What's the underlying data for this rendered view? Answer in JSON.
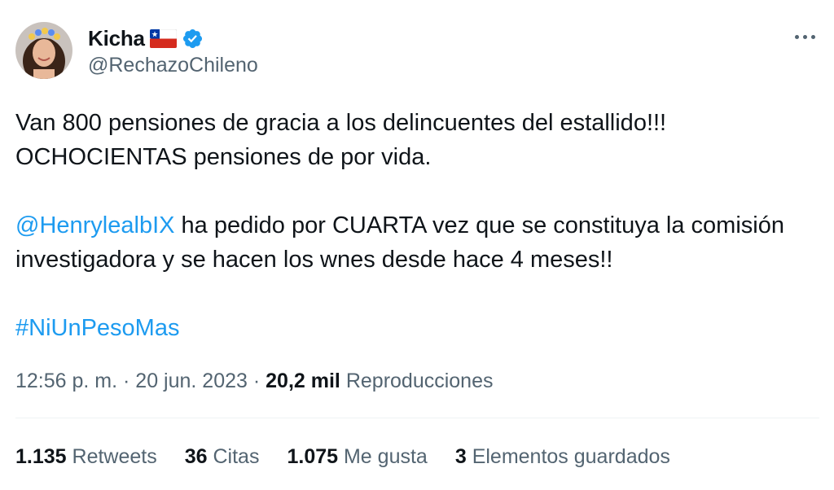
{
  "author": {
    "display_name": "Kicha",
    "handle": "@RechazoChileno",
    "flag_icon": "chile-flag-icon",
    "verified_icon": "verified-badge-icon",
    "verified_color": "#1d9bf0"
  },
  "more_icon": "more-horizontal-icon",
  "tweet": {
    "line1": "Van 800 pensiones de gracia a los delincuentes del estallido!!!",
    "line2": "OCHOCIENTAS pensiones de por vida.",
    "mention": "@HenrylealbIX",
    "line3_rest": " ha pedido por CUARTA vez que se constituya la comisión",
    "line4": "investigadora y se hacen los wnes desde hace 4 meses!!",
    "hashtag": "#NiUnPesoMas"
  },
  "meta": {
    "time": "12:56 p. m.",
    "separator": " · ",
    "date": "20 jun. 2023",
    "views_count": "20,2 mil",
    "views_label": "Reproducciones"
  },
  "stats": [
    {
      "count": "1.135",
      "label": "Retweets"
    },
    {
      "count": "36",
      "label": "Citas"
    },
    {
      "count": "1.075",
      "label": "Me gusta"
    },
    {
      "count": "3",
      "label": "Elementos guardados"
    }
  ],
  "colors": {
    "link": "#1d9bf0",
    "text": "#0f1419",
    "secondary": "#536471",
    "divider": "#eff3f4"
  }
}
